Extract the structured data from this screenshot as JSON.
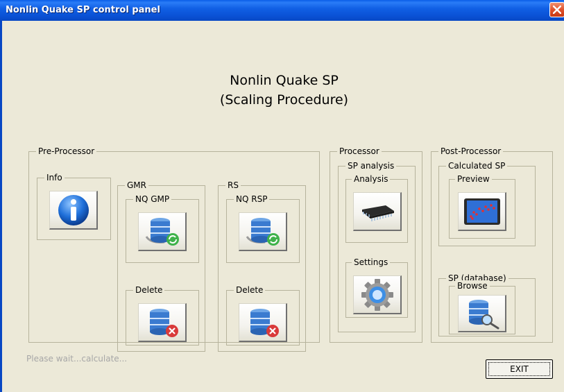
{
  "window": {
    "title": "Nonlin Quake SP control panel"
  },
  "heading": {
    "line1": "Nonlin Quake SP",
    "line2": "(Scaling Procedure)"
  },
  "pre_processor": {
    "label": "Pre-Processor",
    "info": {
      "label": "Info"
    },
    "gmr": {
      "label": "GMR",
      "nq_gmp": "NQ GMP",
      "delete": "Delete"
    },
    "rs": {
      "label": "RS",
      "nq_rsp": "NQ RSP",
      "delete": "Delete"
    }
  },
  "processor": {
    "label": "Processor",
    "sp_analysis": {
      "label": "SP analysis",
      "analysis": "Analysis",
      "settings": "Settings"
    }
  },
  "post_processor": {
    "label": "Post-Processor",
    "calculated_sp": {
      "label": "Calculated SP",
      "preview": "Preview"
    },
    "sp_database": {
      "label": "SP (database)",
      "browse": "Browse"
    }
  },
  "status": {
    "text": "Please wait...calculate..."
  },
  "exit_button": {
    "label": "EXIT"
  },
  "colors": {
    "title_bar": "#0a5ee8",
    "window_bg": "#ece9d8",
    "close_button": "#e0512b",
    "status_text": "#a7a7a7"
  }
}
